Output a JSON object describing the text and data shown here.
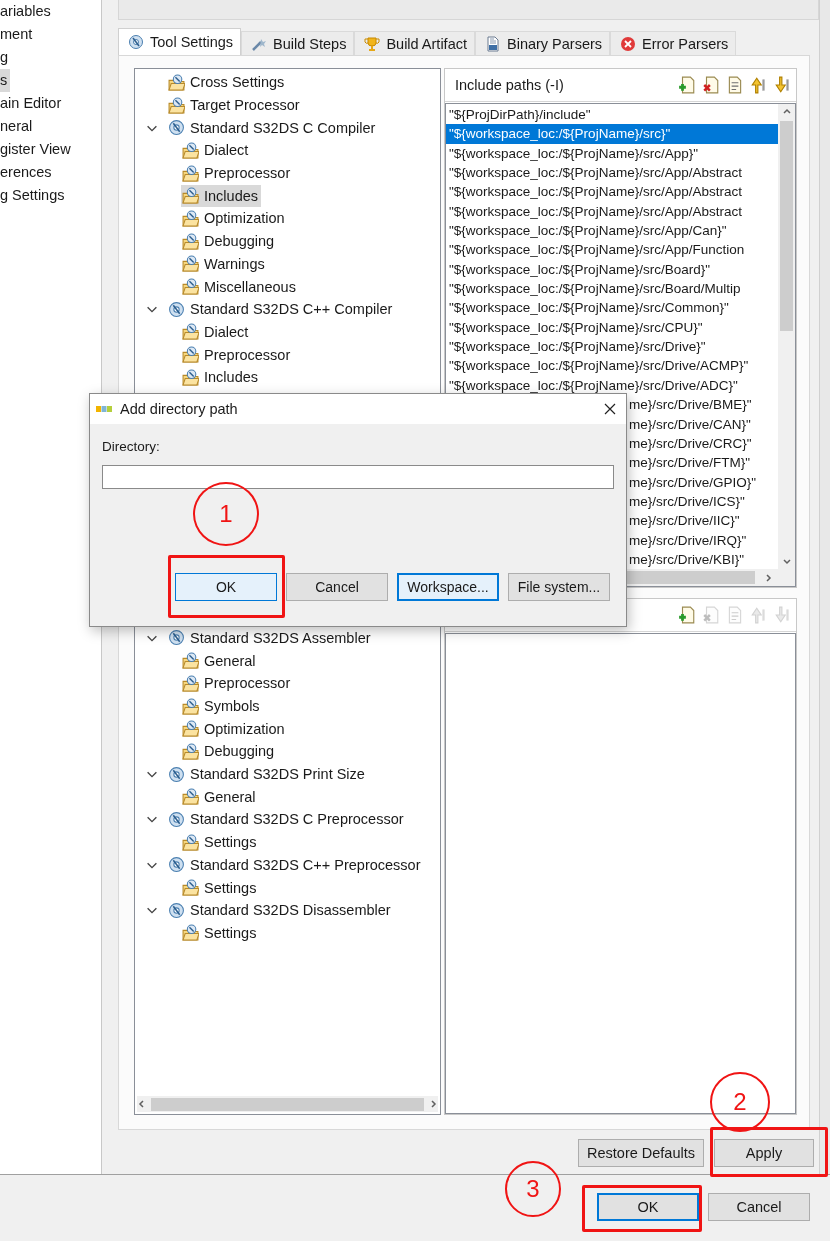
{
  "sidebar": {
    "items": [
      {
        "label": "ariables",
        "selected": false
      },
      {
        "label": "ment",
        "selected": false
      },
      {
        "label": "g",
        "selected": false
      },
      {
        "label": "s",
        "selected": true
      },
      {
        "label": "ain Editor",
        "selected": false
      },
      {
        "label": "neral",
        "selected": false
      },
      {
        "label": "gister View",
        "selected": false
      },
      {
        "label": "erences",
        "selected": false
      },
      {
        "label": "g Settings",
        "selected": false
      }
    ]
  },
  "tabs": [
    {
      "label": "Tool Settings",
      "selected": true,
      "kind": "gear"
    },
    {
      "label": "Build Steps",
      "selected": false,
      "kind": "wand"
    },
    {
      "label": "Build Artifact",
      "selected": false,
      "kind": "trophy"
    },
    {
      "label": "Binary Parsers",
      "selected": false,
      "kind": "binary"
    },
    {
      "label": "Error Parsers",
      "selected": false,
      "kind": "error"
    }
  ],
  "tree": [
    {
      "label": "Cross Settings",
      "selected": false
    },
    {
      "label": "Target Processor",
      "selected": false
    },
    {
      "label": "Standard S32DS C Compiler",
      "selected": false,
      "expanded": true,
      "children": [
        {
          "label": "Dialect",
          "selected": false
        },
        {
          "label": "Preprocessor",
          "selected": false
        },
        {
          "label": "Includes",
          "selected": true
        },
        {
          "label": "Optimization",
          "selected": false
        },
        {
          "label": "Debugging",
          "selected": false
        },
        {
          "label": "Warnings",
          "selected": false
        },
        {
          "label": "Miscellaneous",
          "selected": false
        }
      ]
    },
    {
      "label": "Standard S32DS C++ Compiler",
      "selected": false,
      "expanded": true,
      "children": [
        {
          "label": "Dialect",
          "selected": false
        },
        {
          "label": "Preprocessor",
          "selected": false
        },
        {
          "label": "Includes",
          "selected": false
        }
      ]
    },
    {
      "label": "Standard S32DS Assembler",
      "selected": false,
      "expanded": true,
      "children": [
        {
          "label": "General",
          "selected": false
        },
        {
          "label": "Preprocessor",
          "selected": false
        },
        {
          "label": "Symbols",
          "selected": false
        },
        {
          "label": "Optimization",
          "selected": false
        },
        {
          "label": "Debugging",
          "selected": false
        }
      ]
    },
    {
      "label": "Standard S32DS Print Size",
      "selected": false,
      "expanded": true,
      "children": [
        {
          "label": "General",
          "selected": false
        }
      ]
    },
    {
      "label": "Standard S32DS C Preprocessor",
      "selected": false,
      "expanded": true,
      "children": [
        {
          "label": "Settings",
          "selected": false
        }
      ]
    },
    {
      "label": "Standard S32DS C++ Preprocessor",
      "selected": false,
      "expanded": true,
      "children": [
        {
          "label": "Settings",
          "selected": false
        }
      ]
    },
    {
      "label": "Standard S32DS Disassembler",
      "selected": false,
      "expanded": true,
      "children": [
        {
          "label": "Settings",
          "selected": false
        }
      ]
    }
  ],
  "include_paths": {
    "title": "Include paths (-I)",
    "toolbar": [
      {
        "kind": "add",
        "disabled": false
      },
      {
        "kind": "delete",
        "disabled": false
      },
      {
        "kind": "edit",
        "disabled": false
      },
      {
        "kind": "up",
        "disabled": false
      },
      {
        "kind": "down",
        "disabled": false
      }
    ],
    "rows": [
      {
        "text": "\"${ProjDirPath}/include\"",
        "selected": false,
        "kind": "full"
      },
      {
        "text": "\"${workspace_loc:/${ProjName}/src}\"",
        "selected": true,
        "kind": "full"
      },
      {
        "text": "\"${workspace_loc:/${ProjName}/src/App}\"",
        "selected": false,
        "kind": "full"
      },
      {
        "text": "\"${workspace_loc:/${ProjName}/src/App/Abstract",
        "selected": false,
        "kind": "full"
      },
      {
        "text": "\"${workspace_loc:/${ProjName}/src/App/Abstract",
        "selected": false,
        "kind": "full"
      },
      {
        "text": "\"${workspace_loc:/${ProjName}/src/App/Abstract",
        "selected": false,
        "kind": "full"
      },
      {
        "text": "\"${workspace_loc:/${ProjName}/src/App/Can}\"",
        "selected": false,
        "kind": "full"
      },
      {
        "text": "\"${workspace_loc:/${ProjName}/src/App/Function",
        "selected": false,
        "kind": "full"
      },
      {
        "text": "\"${workspace_loc:/${ProjName}/src/Board}\"",
        "selected": false,
        "kind": "full"
      },
      {
        "text": "\"${workspace_loc:/${ProjName}/src/Board/Multip",
        "selected": false,
        "kind": "full"
      },
      {
        "text": "\"${workspace_loc:/${ProjName}/src/Common}\"",
        "selected": false,
        "kind": "full"
      },
      {
        "text": "\"${workspace_loc:/${ProjName}/src/CPU}\"",
        "selected": false,
        "kind": "full"
      },
      {
        "text": "\"${workspace_loc:/${ProjName}/src/Drive}\"",
        "selected": false,
        "kind": "full"
      },
      {
        "text": "\"${workspace_loc:/${ProjName}/src/Drive/ACMP}\"",
        "selected": false,
        "kind": "full"
      },
      {
        "text": "\"${workspace_loc:/${ProjName}/src/Drive/ADC}\"",
        "selected": false,
        "kind": "full"
      },
      {
        "text": "me}/src/Drive/BME}\"",
        "selected": false,
        "kind": "partial"
      },
      {
        "text": "me}/src/Drive/CAN}\"",
        "selected": false,
        "kind": "partial"
      },
      {
        "text": "me}/src/Drive/CRC}\"",
        "selected": false,
        "kind": "partial"
      },
      {
        "text": "me}/src/Drive/FTM}\"",
        "selected": false,
        "kind": "partial"
      },
      {
        "text": "me}/src/Drive/GPIO}\"",
        "selected": false,
        "kind": "partial"
      },
      {
        "text": "me}/src/Drive/ICS}\"",
        "selected": false,
        "kind": "partial"
      },
      {
        "text": "me}/src/Drive/IIC}\"",
        "selected": false,
        "kind": "partial"
      },
      {
        "text": "me}/src/Drive/IRQ}\"",
        "selected": false,
        "kind": "partial"
      },
      {
        "text": "me}/src/Drive/KBI}\"",
        "selected": false,
        "kind": "partial"
      }
    ]
  },
  "second_panel": {
    "toolbar": [
      {
        "kind": "add",
        "disabled": false
      },
      {
        "kind": "delete",
        "disabled": true
      },
      {
        "kind": "edit",
        "disabled": true
      },
      {
        "kind": "up",
        "disabled": true
      },
      {
        "kind": "down",
        "disabled": true
      }
    ]
  },
  "buttons": [
    {
      "label": "Restore Defaults"
    },
    {
      "label": "Apply"
    }
  ],
  "dialog": {
    "title": "Add directory path",
    "field_label": "Directory:",
    "buttons": [
      {
        "label": "OK",
        "kind": "default"
      },
      {
        "label": "Cancel",
        "kind": "normal"
      },
      {
        "label": "Workspace...",
        "kind": "focused"
      },
      {
        "label": "File system...",
        "kind": "normal"
      }
    ]
  },
  "footer_buttons": [
    {
      "label": "OK",
      "kind": "default"
    },
    {
      "label": "Cancel",
      "kind": "normal"
    }
  ],
  "annotations": [
    {
      "label": "1"
    },
    {
      "label": "2"
    },
    {
      "label": "3"
    }
  ]
}
